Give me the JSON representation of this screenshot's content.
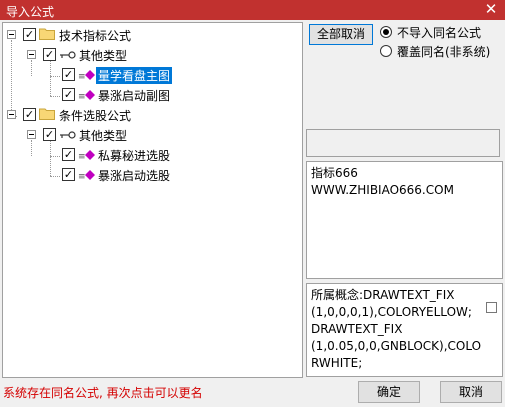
{
  "window": {
    "title": "导入公式",
    "close_glyph": "✕"
  },
  "tree": {
    "root1": {
      "label": "技术指标公式",
      "checked": "✓"
    },
    "group1": {
      "label": "其他类型",
      "checked": "✓"
    },
    "item1": {
      "label": "量学看盘主图",
      "checked": "✓",
      "selected": true
    },
    "item2": {
      "label": "暴涨启动副图",
      "checked": "✓"
    },
    "root2": {
      "label": "条件选股公式",
      "checked": "✓"
    },
    "group2": {
      "label": "其他类型",
      "checked": "✓"
    },
    "item3": {
      "label": "私募秘进选股",
      "checked": "✓"
    },
    "item4": {
      "label": "暴涨启动选股",
      "checked": "✓"
    }
  },
  "options": {
    "deselect_all": "全部取消",
    "radio1": "不导入同名公式",
    "radio2": "覆盖同名(非系统)",
    "radio1_selected": true
  },
  "info": {
    "line1": "指标666",
    "line2": "WWW.ZHIBIAO666.COM"
  },
  "concept": {
    "lines": [
      "所属概念:DRAWTEXT_FIX",
      "(1,0,0,0,1),COLORYELLOW;",
      "DRAWTEXT_FIX",
      "(1,0.05,0,0,GNBLOCK),COLO",
      "RWHITE;"
    ]
  },
  "footer": {
    "status": "系统存在同名公式, 再次点击可以更名",
    "ok": "确定",
    "cancel": "取消"
  },
  "colors": {
    "titlebar": "#c1312f",
    "selection": "#0078d7",
    "status": "#d40000"
  }
}
